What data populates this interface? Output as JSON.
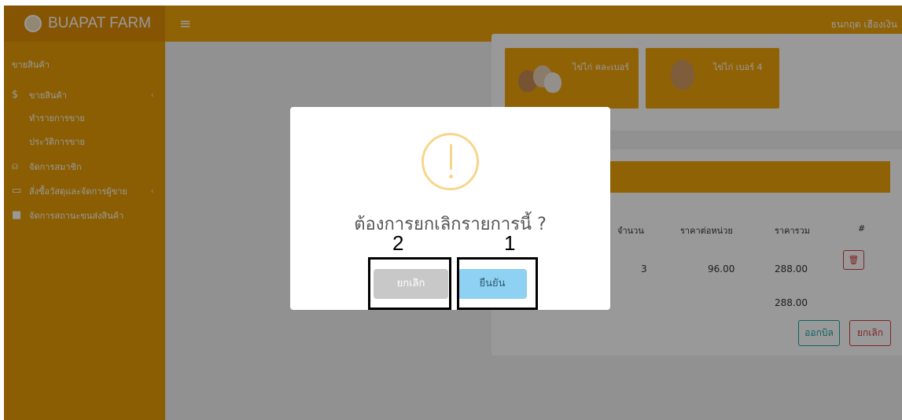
{
  "app": {
    "brand": "BUAPAT FARM",
    "user": "ธนกฤต เฮืองเงิน",
    "menu_icon": "hamburger-icon"
  },
  "sidebar": {
    "section": "ขายสินค้า",
    "items": [
      {
        "label": "ขายสินค้า",
        "icon": "dollar-icon"
      },
      {
        "label": "ทำรายการขาย",
        "sub": true
      },
      {
        "label": "ประวัติการขาย",
        "sub": true
      },
      {
        "label": "จัดการสมาชิก",
        "icon": "user-icon"
      },
      {
        "label": "สั่งซื้อวัสดุและจัดการผู้ขาย",
        "icon": "folder-icon"
      },
      {
        "label": "จัดการสถานะขนส่งสินค้า",
        "icon": "truck-icon"
      }
    ]
  },
  "products": [
    {
      "label": "ไข่ไก่ คละเบอร์"
    },
    {
      "label": "ไข่ไก่ เบอร์ 4"
    }
  ],
  "cart": {
    "columns": [
      "จำนวน",
      "ราคาต่อหน่วย",
      "ราคารวม",
      "#"
    ],
    "row": {
      "qty": "3",
      "unit_price": "96.00",
      "total": "288.00"
    },
    "grand_total": "288.00",
    "bill_label": "ออกบิล",
    "cancel_label": "ยกเลิก"
  },
  "dialog": {
    "title": "ต้องการยกเลิกรายการนี้ ?",
    "cancel_label": "ยกเลิก",
    "confirm_label": "ยืนยัน",
    "icon": "warning-icon"
  },
  "annotations": [
    {
      "label": "1",
      "target": "confirm"
    },
    {
      "label": "2",
      "target": "cancel"
    }
  ],
  "colors": {
    "primary": "#f0a30a",
    "confirm": "#8fd1f2",
    "cancel": "#c8c8c8",
    "warning": "#f8d58a"
  }
}
